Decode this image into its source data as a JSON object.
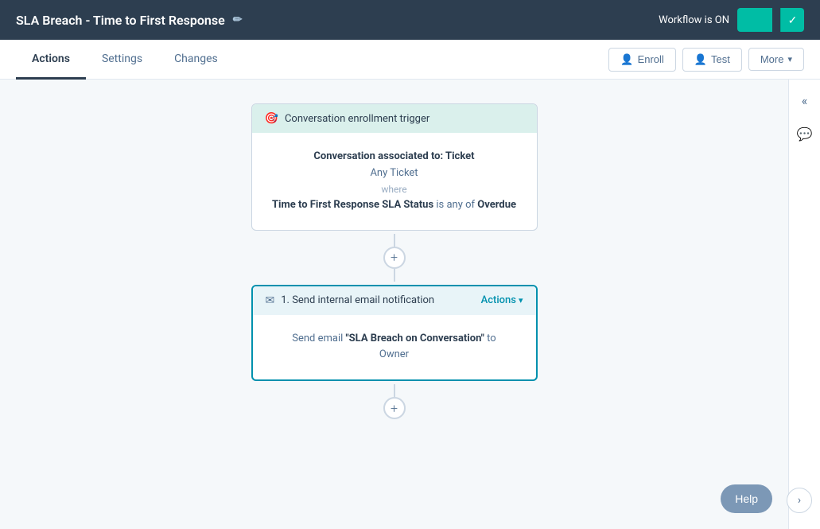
{
  "header": {
    "title": "SLA Breach - Time to First Response",
    "workflow_status": "Workflow is ON",
    "edit_icon": "✏",
    "check_icon": "✓"
  },
  "nav": {
    "tabs": [
      {
        "label": "Actions",
        "active": true
      },
      {
        "label": "Settings",
        "active": false
      },
      {
        "label": "Changes",
        "active": false
      }
    ],
    "buttons": {
      "enroll": "Enroll",
      "test": "Test",
      "more": "More"
    }
  },
  "trigger": {
    "header_label": "Conversation enrollment trigger",
    "header_icon": "🎯",
    "association": "Conversation associated to: Ticket",
    "ticket_type": "Any Ticket",
    "where_label": "where",
    "condition_field": "Time to First Response SLA Status",
    "condition_verb": "is",
    "condition_detail": "any of",
    "condition_value": "Overdue"
  },
  "add_button_1": "+",
  "add_button_2": "+",
  "action": {
    "step_label": "1. Send internal email notification",
    "actions_link": "Actions",
    "chevron": "▾",
    "email_icon": "✉",
    "body_text_prefix": "Send email ",
    "email_name": "\"SLA Breach on Conversation\"",
    "body_text_suffix": " to",
    "recipient": "Owner"
  },
  "sidebar": {
    "collapse_icon": "«",
    "chat_icon": "💬"
  },
  "help_button": "Help",
  "next_button": "›"
}
